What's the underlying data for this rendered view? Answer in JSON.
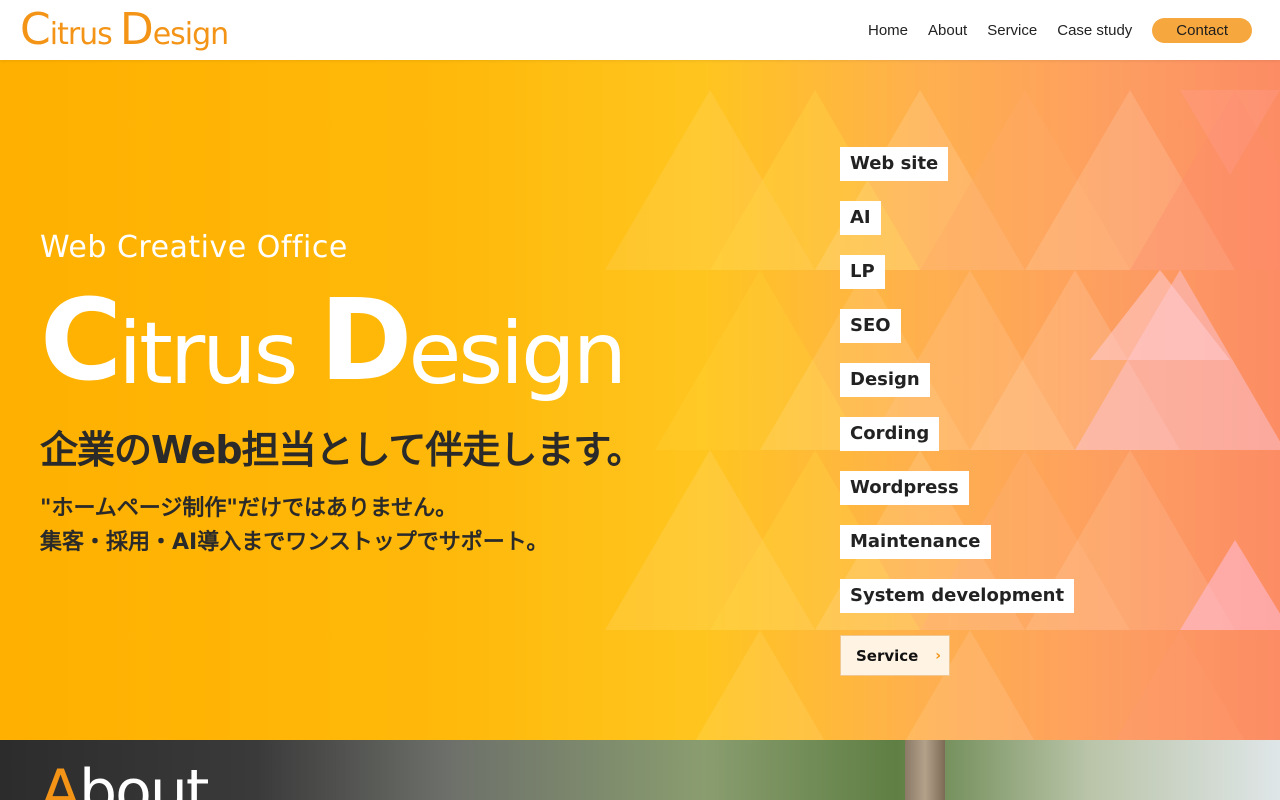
{
  "header": {
    "logo_first": "C",
    "logo_rest": "itrus",
    "logo_first2": "D",
    "logo_rest2": "esign",
    "nav": [
      "Home",
      "About",
      "Service",
      "Case study"
    ],
    "contact": "Contact"
  },
  "hero": {
    "tagline": "Web Creative Office",
    "logo_first": "C",
    "logo_rest": "itrus",
    "logo_first2": "D",
    "logo_rest2": "esign",
    "headline": "企業のWeb担当として伴走します。",
    "sub_line1": "\"ホームページ制作\"だけではありません。",
    "sub_line2": "集客・採用・AI導入までワンストップでサポート。",
    "tags": [
      "Web site",
      "AI",
      "LP",
      "SEO",
      "Design",
      "Cording",
      "Wordpress",
      "Maintenance",
      "System development"
    ],
    "service_button": "Service",
    "service_icon": "chevron-right-icon"
  },
  "about": {
    "title_first": "A",
    "title_rest": "bout"
  },
  "colors": {
    "brand_orange": "#f39417",
    "contact_bg": "#f6a73e",
    "hero_start": "#ffb000",
    "hero_end": "#fc8c64"
  }
}
